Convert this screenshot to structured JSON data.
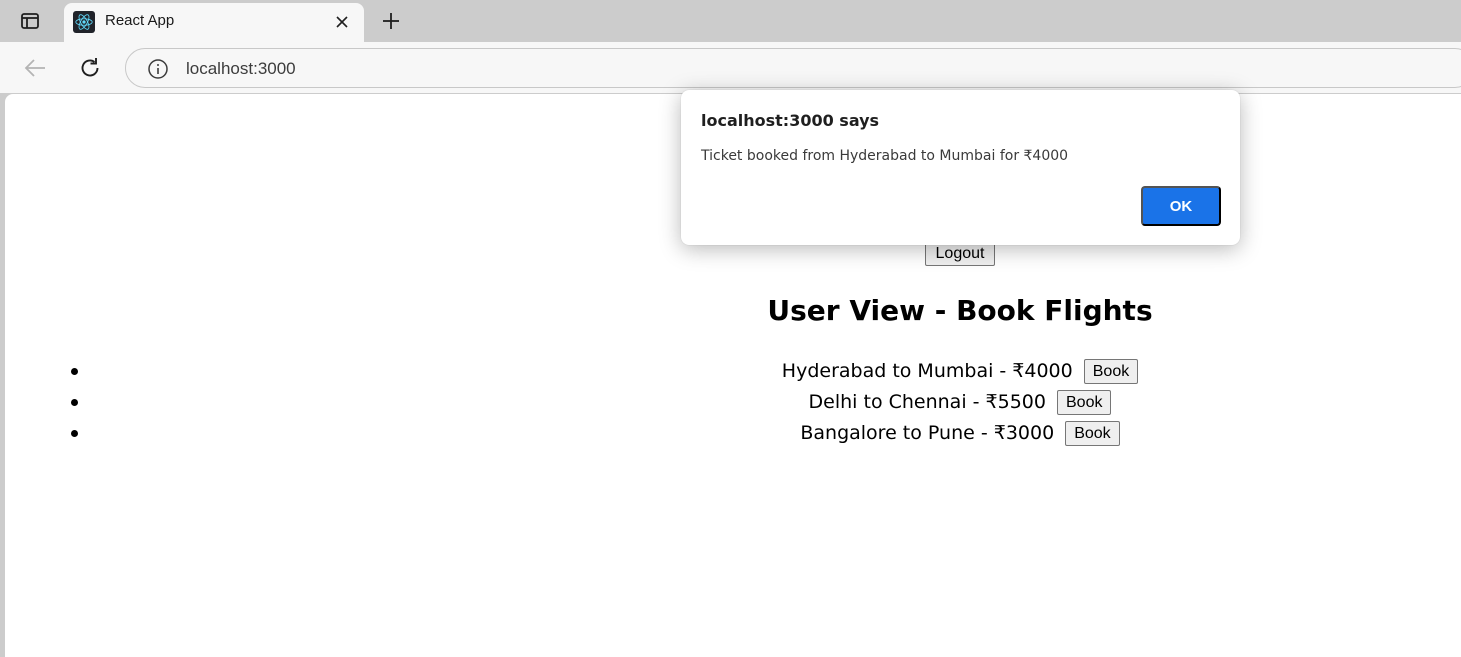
{
  "browser": {
    "tab": {
      "title": "React App",
      "favicon": "react-logo-icon"
    },
    "address_bar": {
      "url": "localhost:3000"
    }
  },
  "page": {
    "logout_label": "Logout",
    "heading": "User View - Book Flights",
    "flights": [
      {
        "route": "Hyderabad to Mumbai - ₹4000",
        "book_label": "Book"
      },
      {
        "route": "Delhi to Chennai - ₹5500",
        "book_label": "Book"
      },
      {
        "route": "Bangalore to Pune - ₹3000",
        "book_label": "Book"
      }
    ]
  },
  "dialog": {
    "title": "localhost:3000 says",
    "message": "Ticket booked from Hyderabad to Mumbai for ₹4000",
    "ok_label": "OK"
  },
  "colors": {
    "accent": "#1a73e8",
    "chrome_bg": "#cccccc",
    "toolbar_bg": "#f7f7f7"
  }
}
